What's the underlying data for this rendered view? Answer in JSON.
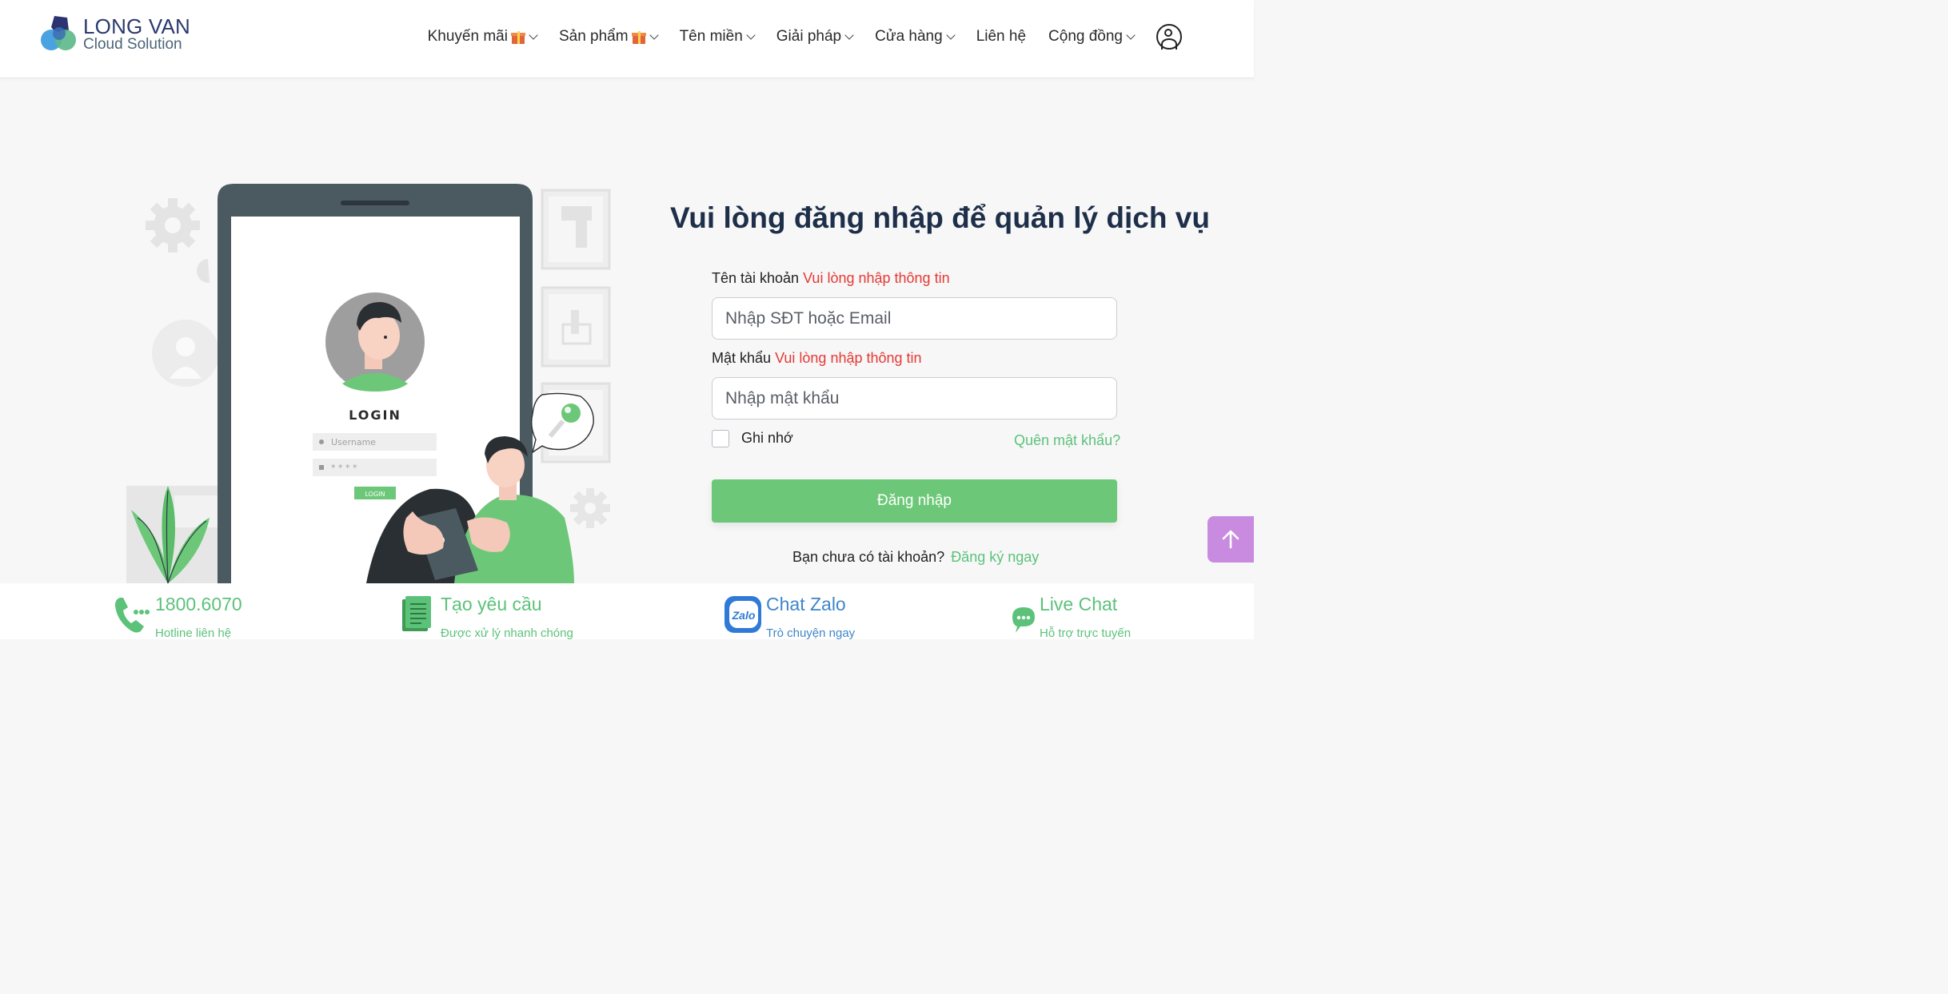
{
  "header": {
    "logo": {
      "line1": "LONG VAN",
      "line2": "Cloud Solution"
    },
    "nav": [
      {
        "label": "Khuyến mãi",
        "gift": true,
        "dropdown": true
      },
      {
        "label": "Sản phẩm",
        "gift": true,
        "dropdown": true
      },
      {
        "label": "Tên miền",
        "gift": false,
        "dropdown": true
      },
      {
        "label": "Giải pháp",
        "gift": false,
        "dropdown": true
      },
      {
        "label": "Cửa hàng",
        "gift": false,
        "dropdown": true
      },
      {
        "label": "Liên hệ",
        "gift": false,
        "dropdown": false
      },
      {
        "label": "Cộng đồng",
        "gift": false,
        "dropdown": true
      }
    ],
    "account_icon": "user-circle-icon"
  },
  "illustration": {
    "login_title": "LOGIN",
    "username_placeholder": "Username",
    "password_mask": "* * * *",
    "login_button": "LOGIN"
  },
  "form": {
    "title": "Vui lòng đăng nhập để quản lý dịch vụ",
    "username_label": "Tên tài khoản",
    "username_error": "Vui lòng nhập thông tin",
    "username_placeholder": "Nhập SĐT hoặc Email",
    "password_label": "Mật khẩu",
    "password_error": "Vui lòng nhập thông tin",
    "password_placeholder": "Nhập mật khẩu",
    "remember_label": "Ghi nhớ",
    "remember_checked": false,
    "forgot_link": "Quên mật khẩu?",
    "submit_label": "Đăng nhập",
    "signup_prompt": "Bạn chưa có tài khoản?",
    "signup_link": "Đăng ký ngay"
  },
  "bottom_bar": {
    "hotline": {
      "title": "1800.6070",
      "subtitle": "Hotline liên hệ",
      "icon": "phone-icon"
    },
    "request": {
      "title": "Tạo yêu cầu",
      "subtitle": "Được xử lý nhanh chóng",
      "icon": "document-icon"
    },
    "zalo": {
      "title": "Chat Zalo",
      "subtitle": "Trò chuyện ngay",
      "icon": "zalo-icon",
      "icon_text": "Zalo"
    },
    "livechat": {
      "title": "Live Chat",
      "subtitle": "Hỗ trợ trực tuyến",
      "icon": "chat-bubble-icon"
    }
  },
  "colors": {
    "accent_green": "#6cc878",
    "error_red": "#e53935",
    "title_navy": "#1e2f4a",
    "zalo_blue": "#3f86c9",
    "scroll_top_purple": "#c98be0"
  }
}
